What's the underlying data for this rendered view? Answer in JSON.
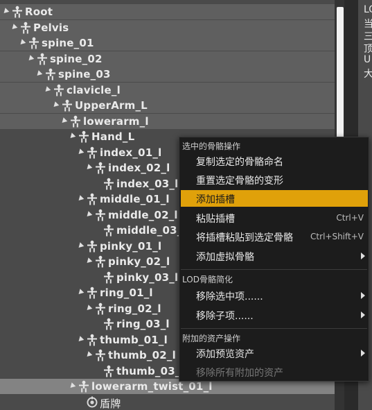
{
  "tree": {
    "nodes": [
      {
        "label": "Root",
        "icon": "bone-icon"
      },
      {
        "label": "Pelvis",
        "icon": "bone-icon"
      },
      {
        "label": "spine_01",
        "icon": "bone-icon"
      },
      {
        "label": "spine_02",
        "icon": "bone-icon"
      },
      {
        "label": "spine_03",
        "icon": "bone-icon"
      },
      {
        "label": "clavicle_l",
        "icon": "bone-icon"
      },
      {
        "label": "UpperArm_L",
        "icon": "bone-icon"
      },
      {
        "label": "lowerarm_l",
        "icon": "bone-icon"
      },
      {
        "label": "Hand_L",
        "icon": "bone-icon"
      },
      {
        "label": "index_01_l",
        "icon": "bone-icon"
      },
      {
        "label": "index_02_l",
        "icon": "bone-icon"
      },
      {
        "label": "index_03_l",
        "icon": "bone-icon"
      },
      {
        "label": "middle_01_l",
        "icon": "bone-icon"
      },
      {
        "label": "middle_02_l",
        "icon": "bone-icon"
      },
      {
        "label": "middle_03_l",
        "icon": "bone-icon"
      },
      {
        "label": "pinky_01_l",
        "icon": "bone-icon"
      },
      {
        "label": "pinky_02_l",
        "icon": "bone-icon"
      },
      {
        "label": "pinky_03_l",
        "icon": "bone-icon"
      },
      {
        "label": "ring_01_l",
        "icon": "bone-icon"
      },
      {
        "label": "ring_02_l",
        "icon": "bone-icon"
      },
      {
        "label": "ring_03_l",
        "icon": "bone-icon"
      },
      {
        "label": "thumb_01_l",
        "icon": "bone-icon"
      },
      {
        "label": "thumb_02_l",
        "icon": "bone-icon"
      },
      {
        "label": "thumb_03_l",
        "icon": "bone-icon"
      },
      {
        "label": "lowerarm_twist_01_l",
        "icon": "bone-icon"
      },
      {
        "label": "盾牌",
        "icon": "socket-icon"
      }
    ]
  },
  "right_panel": {
    "lines": [
      "LO",
      "当",
      "三",
      "顶",
      "U",
      "大"
    ]
  },
  "context_menu": {
    "section_selected_bone": "选中的骨骼操作",
    "copy_bone_names": "复制选定的骨骼命名",
    "reset_bone_transform": "重置选定骨骼的变形",
    "add_socket": "添加插槽",
    "paste_socket": "粘贴插槽",
    "paste_socket_shortcut": "Ctrl+V",
    "paste_socket_to_bone": "将插槽粘贴到选定骨骼",
    "paste_socket_to_bone_shortcut": "Ctrl+Shift+V",
    "add_virtual_bone": "添加虚拟骨骼",
    "section_lod": "LOD骨骼简化",
    "remove_selected": "移除选中项......",
    "remove_children": "移除子项......",
    "section_attached_assets": "附加的资产操作",
    "add_preview_asset": "添加预览资产",
    "remove_all_attached": "移除所有附加的资产"
  },
  "colors": {
    "menu_highlight": "#e0a10a",
    "tree_background": "#4a4a4a",
    "selected_row": "#838383"
  }
}
